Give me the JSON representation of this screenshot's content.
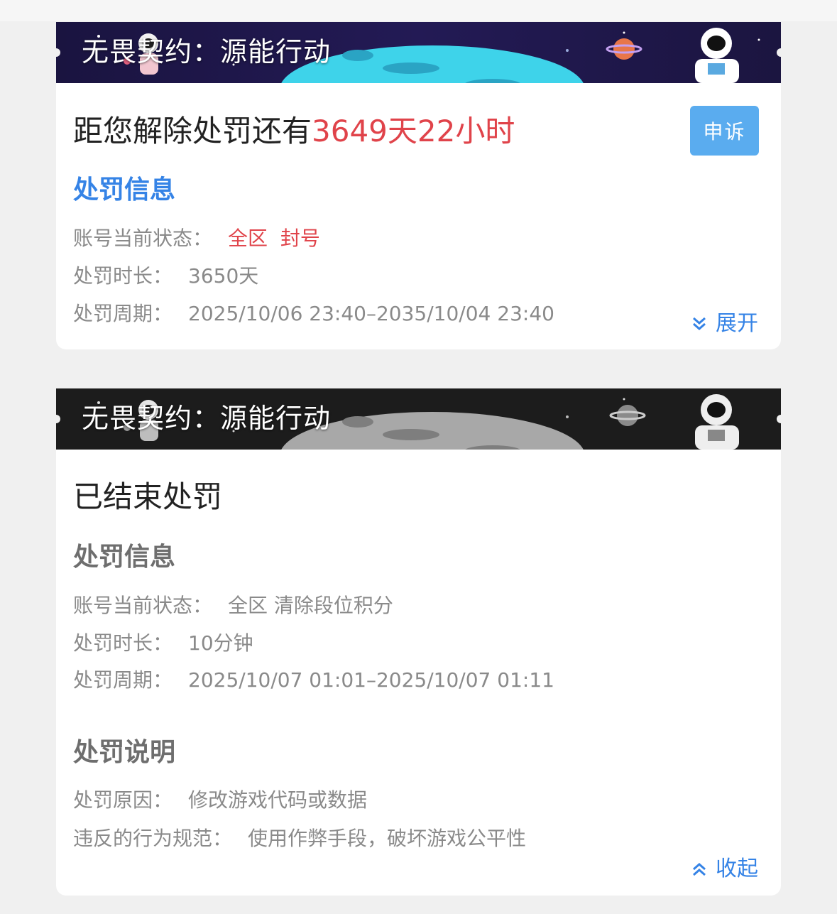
{
  "card1": {
    "banner_title": "无畏契约：源能行动",
    "headline_prefix": "距您解除处罚还有",
    "headline_remaining": "3649天22小时",
    "appeal_label": "申诉",
    "section_title": "处罚信息",
    "status_label": "账号当前状态：",
    "status_value": "全区  封号",
    "duration_label": "处罚时长：",
    "duration_value": "3650天",
    "period_label": "处罚周期：",
    "period_value": "2025/10/06 23:40–2035/10/04 23:40",
    "toggle_label": "展开",
    "toggle_icon": "chevron-double-down-icon"
  },
  "card2": {
    "banner_title": "无畏契约：源能行动",
    "headline": "已结束处罚",
    "section_title": "处罚信息",
    "status_label": "账号当前状态：",
    "status_value": "全区 清除段位积分",
    "duration_label": "处罚时长：",
    "duration_value": "10分钟",
    "period_label": "处罚周期：",
    "period_value": "2025/10/07 01:01–2025/10/07 01:11",
    "desc_title": "处罚说明",
    "reason_label": "处罚原因：",
    "reason_value": "修改游戏代码或数据",
    "rule_label": "违反的行为规范：",
    "rule_value": "使用作弊手段，破坏游戏公平性",
    "toggle_label": "收起",
    "toggle_icon": "chevron-double-up-icon"
  },
  "colors": {
    "accent_blue": "#3583e6",
    "alert_red": "#e0434a",
    "appeal_button": "#5aacef"
  }
}
